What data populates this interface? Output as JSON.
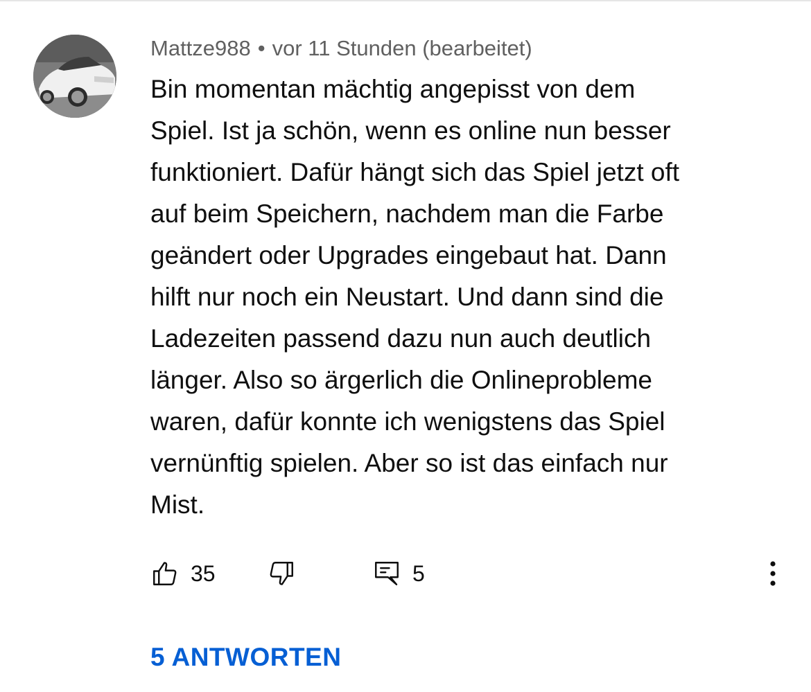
{
  "comment": {
    "author": "Mattze988",
    "separator": "•",
    "timestamp": "vor 11 Stunden (bearbeitet)",
    "avatar_icon": "car-photo-avatar",
    "text_lines": [
      "Bin momentan mächtig angepisst von dem",
      "Spiel. Ist ja schön, wenn es online nun besser",
      "funktioniert. Dafür hängt sich das Spiel jetzt oft",
      "auf beim Speichern, nachdem man die Farbe",
      "geändert oder Upgrades eingebaut hat. Dann",
      "hilft nur noch ein Neustart. Und dann sind die",
      "Ladezeiten passend dazu nun auch deutlich",
      "länger. Also so ärgerlich die Onlineprobleme",
      "waren, dafür konnte ich wenigstens das Spiel",
      "vernünftig spielen. Aber so ist das einfach nur",
      "Mist."
    ]
  },
  "actions": {
    "like_count": "35",
    "like_icon": "thumbs-up-icon",
    "dislike_icon": "thumbs-down-icon",
    "reply_icon": "comment-reply-icon",
    "reply_count": "5",
    "more_icon": "more-vertical-icon"
  },
  "replies": {
    "label": "5 ANTWORTEN"
  },
  "colors": {
    "meta_text": "#606060",
    "body_text": "#0f0f0f",
    "link": "#065fd4"
  }
}
